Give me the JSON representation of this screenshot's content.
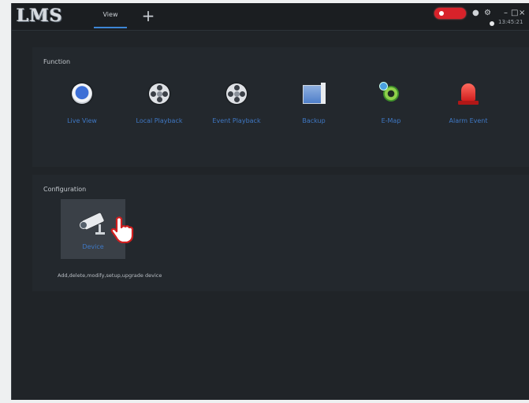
{
  "app": {
    "logo_text": "LMS",
    "tab_label": "View",
    "add_tab_symbol": "+",
    "clock_text": "13:45:21"
  },
  "colors": {
    "background": "#202428",
    "panel": "#23282d",
    "accent_blue": "#3f78c4",
    "alarm_red": "#d8222a"
  },
  "function_section": {
    "title": "Function",
    "items": [
      {
        "label": "Live View",
        "icon": "live-view-icon"
      },
      {
        "label": "Local Playback",
        "icon": "film-reel-icon"
      },
      {
        "label": "Event Playback",
        "icon": "film-reel-icon"
      },
      {
        "label": "Backup",
        "icon": "backup-icon"
      },
      {
        "label": "E-Map",
        "icon": "e-map-icon"
      },
      {
        "label": "Alarm Event",
        "icon": "alarm-light-icon"
      }
    ]
  },
  "configuration_section": {
    "title": "Configuration",
    "device_tile_label": "Device",
    "device_icon": "cctv-camera-icon",
    "hint_text": "Add,delete,modify,setup,upgrade device"
  },
  "titlebar_icons": [
    "alarm-badge",
    "user-icon",
    "gear-icon",
    "minimize-icon",
    "maximize-icon",
    "close-icon"
  ]
}
